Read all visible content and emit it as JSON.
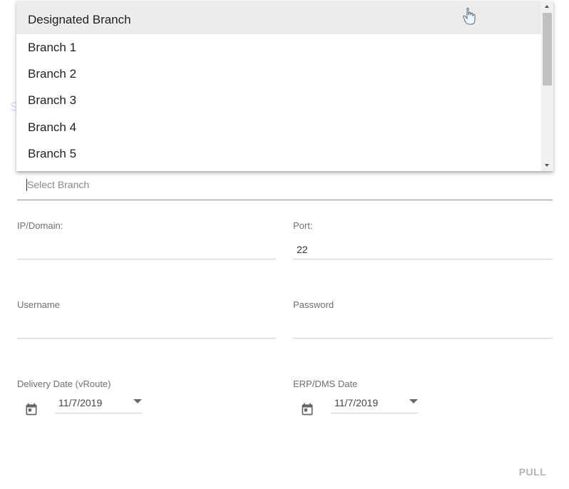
{
  "background_title_fragment": "S",
  "branch_select": {
    "placeholder": "Select Branch",
    "options": [
      "Designated Branch",
      "Branch 1",
      "Branch 2",
      "Branch 3",
      "Branch 4",
      "Branch 5"
    ]
  },
  "fields": {
    "ip_label": "IP/Domain:",
    "ip_value": "",
    "port_label": "Port:",
    "port_value": "22",
    "username_label": "Username",
    "username_value": "",
    "password_label": "Password",
    "password_value": ""
  },
  "dates": {
    "delivery_label": "Delivery Date (vRoute)",
    "delivery_value": "11/7/2019",
    "erp_label": "ERP/DMS Date",
    "erp_value": "11/7/2019"
  },
  "actions": {
    "pull_label": "PULL"
  },
  "icons": {
    "calendar": "calendar-icon",
    "cursor": "hand-pointer-icon"
  },
  "colors": {
    "highlight": "#ececec",
    "label": "#6f6f6f",
    "button_disabled": "#b3b3b3"
  }
}
